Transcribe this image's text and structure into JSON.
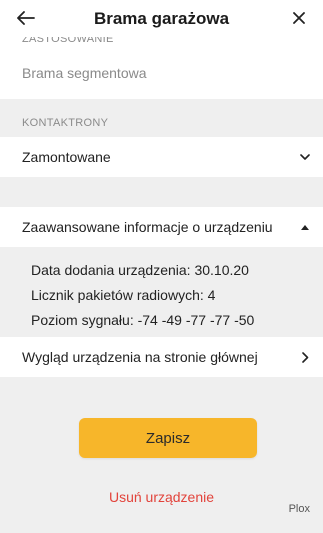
{
  "header": {
    "title": "Brama garażowa",
    "back_icon": "arrow-left-icon",
    "close_icon": "close-icon"
  },
  "usage": {
    "label_clipped": "ZASTOSOWANIE",
    "value": "Brama segmentowa"
  },
  "contacts": {
    "label": "KONTAKTRONY",
    "value": "Zamontowane",
    "icon": "chevron-down-icon"
  },
  "advanced": {
    "label": "Zaawansowane informacje o urządzeniu",
    "icon": "chevron-up-icon",
    "lines": [
      "Data dodania urządzenia: 30.10.20",
      "Licznik pakietów radiowych: 4",
      "Poziom sygnału: -74 -49 -77 -77 -50"
    ]
  },
  "appearance": {
    "label": "Wygląd urządzenia na stronie głównej",
    "icon": "chevron-right-icon"
  },
  "actions": {
    "save_label": "Zapisz",
    "delete_label": "Usuń urządzenie"
  },
  "brand": "Plox",
  "colors": {
    "accent": "#f7b62a",
    "danger": "#e2433b",
    "background": "#efefef",
    "surface": "#ffffff"
  }
}
